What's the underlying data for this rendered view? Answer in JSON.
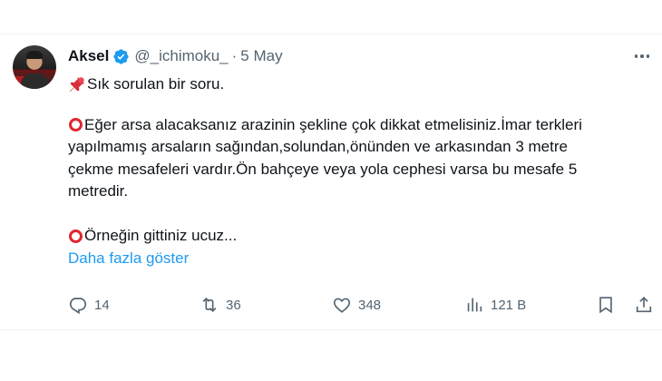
{
  "tweet": {
    "author_name": "Aksel",
    "handle": "@_ichimoku_",
    "separator": "·",
    "date": "5 May",
    "verified_color": "#1d9bf0",
    "lines": {
      "l1": "Sık sorulan bir soru.",
      "l2": "Eğer arsa alacaksanız arazinin şekline çok dikkat etmelisiniz.İmar terkleri",
      "l3": "yapılmamış arsaların sağından,solundan,önünden ve arkasından 3 metre",
      "l4": "çekme mesafeleri vardır.Ön bahçeye veya yola cephesi varsa bu mesafe 5",
      "l5": "metredir.",
      "l6": "Örneğin gittiniz ucuz..."
    },
    "emoji": {
      "pin": "pushpin-icon",
      "circle": "red-circle-icon"
    },
    "show_more": "Daha fazla göster",
    "actions": {
      "replies": "14",
      "retweets": "36",
      "likes": "348",
      "views": "121 B"
    }
  }
}
